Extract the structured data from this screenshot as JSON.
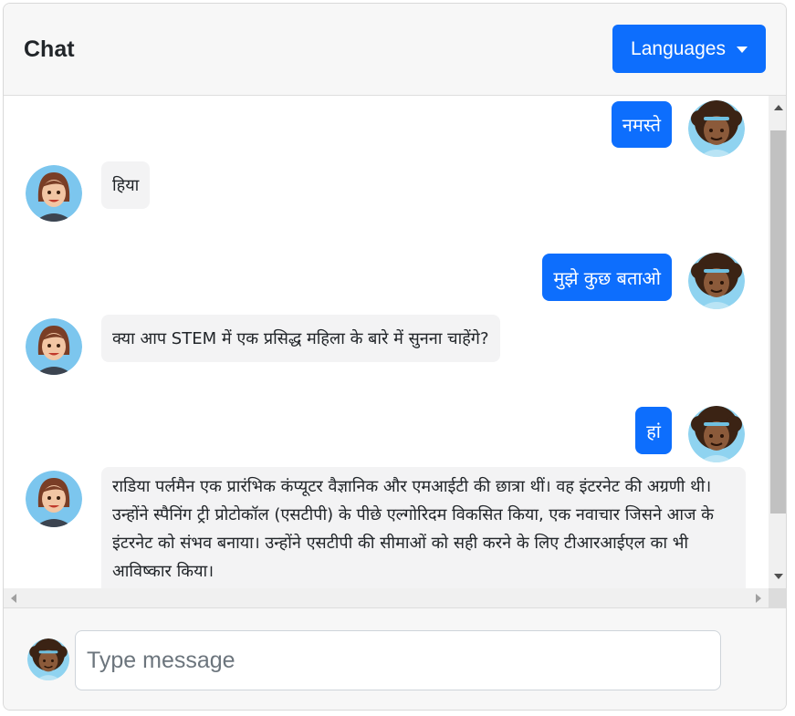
{
  "header": {
    "title": "Chat",
    "languages_label": "Languages"
  },
  "messages": [
    {
      "side": "out",
      "text": "नमस्ते"
    },
    {
      "side": "in",
      "text": "हिया"
    },
    {
      "side": "out",
      "text": "मुझे कुछ बताओ"
    },
    {
      "side": "in",
      "text": "क्या आप STEM में एक प्रसिद्ध महिला के बारे में सुनना चाहेंगे?"
    },
    {
      "side": "out",
      "text": "हां"
    },
    {
      "side": "in",
      "text": "राडिया पर्लमैन एक प्रारंभिक कंप्यूटर वैज्ञानिक और एमआईटी की छात्रा थीं। वह इंटरनेट की अग्रणी थी। उन्होंने स्पैनिंग ट्री प्रोटोकॉल (एसटीपी) के पीछे एल्गोरिदम विकसित किया, एक नवाचार जिसने आज के इंटरनेट को संभव बनाया। उन्होंने एसटीपी की सीमाओं को सही करने के लिए टीआरआईएल का भी आविष्कार किया।"
    }
  ],
  "composer": {
    "placeholder": "Type message"
  },
  "colors": {
    "accent": "#0d6efd",
    "incoming_bubble": "#f3f3f4"
  }
}
